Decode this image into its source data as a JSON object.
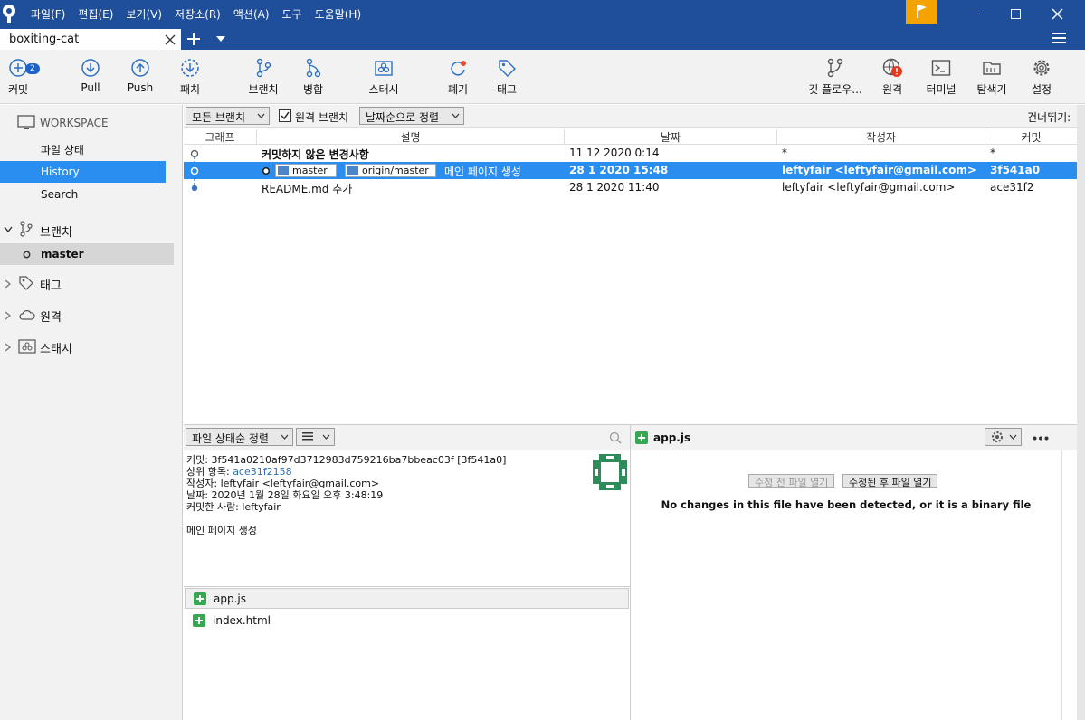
{
  "menu": [
    "파일(F)",
    "편집(E)",
    "보기(V)",
    "저장소(R)",
    "액션(A)",
    "도구",
    "도움말(H)"
  ],
  "tab": {
    "name": "boxiting-cat"
  },
  "toolbar": {
    "commit": "커밋",
    "commit_badge": "2",
    "pull": "Pull",
    "push": "Push",
    "patch": "패치",
    "branch": "브랜치",
    "merge": "병합",
    "stash": "스태시",
    "discard": "폐기",
    "tag": "태그",
    "gitflow": "깃 플로우...",
    "remote": "원격",
    "terminal": "터미널",
    "explorer": "탐색기",
    "settings": "설정"
  },
  "sidebar": {
    "workspace": "WORKSPACE",
    "file_status": "파일 상태",
    "history": "History",
    "search": "Search",
    "branches": "브랜치",
    "master": "master",
    "tags": "태그",
    "remotes": "원격",
    "stashes": "스태시"
  },
  "filter": {
    "branches": "모든 브랜치",
    "remote_branches": "원격 브랜치",
    "sort": "날짜순으로 정렬",
    "skip": "건너뛰기:"
  },
  "columns": {
    "graph": "그래프",
    "desc": "설명",
    "date": "날짜",
    "author": "작성자",
    "commit": "커밋"
  },
  "rows": [
    {
      "desc": "커밋하지 않은 변경사항",
      "date": "11 12 2020 0:14",
      "author": "*",
      "commit": "*"
    },
    {
      "label1": "master",
      "label2": "origin/master",
      "desc": "메인 페이지 생성",
      "date": "28 1 2020 15:48",
      "author": "leftyfair <leftyfair@gmail.com>",
      "commit": "3f541a0"
    },
    {
      "desc": "README.md 추가",
      "date": "28 1 2020 11:40",
      "author": "leftyfair <leftyfair@gmail.com>",
      "commit": "ace31f2"
    }
  ],
  "bottom": {
    "sort": "파일 상태순 정렬",
    "list_icon": "list-icon"
  },
  "details": {
    "commit_k": "커밋:",
    "commit_v": "3f541a0210af97d3712983d759216ba7bbeac03f [3f541a0]",
    "parent_k": "상위 항목:",
    "parent_v": "ace31f2158",
    "author_k": "작성자:",
    "author_v": "leftyfair <leftyfair@gmail.com>",
    "date_k": "날짜:",
    "date_v": "2020년 1월 28일 화요일 오후 3:48:19",
    "committer_k": "커밋한 사람:",
    "committer_v": "leftyfair",
    "message": "메인 페이지 생성"
  },
  "files": [
    "app.js",
    "index.html"
  ],
  "diff": {
    "file": "app.js",
    "open_before": "수정 전 파일 열기",
    "open_after": "수정된 후 파일 열기",
    "message": "No changes in this file have been detected, or it is a binary file"
  }
}
